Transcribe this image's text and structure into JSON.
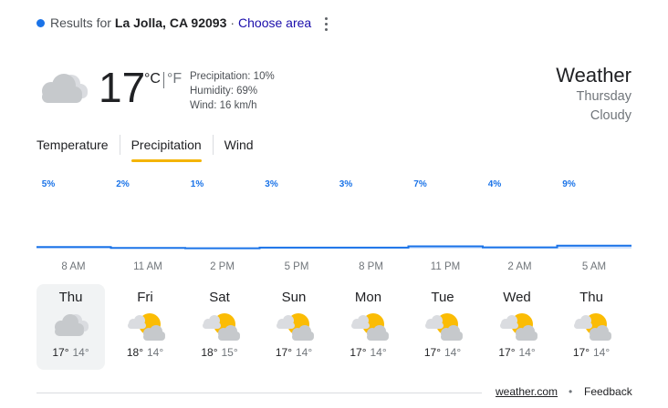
{
  "header": {
    "results_prefix": "Results for",
    "location": "La Jolla, CA 92093",
    "separator": "·",
    "choose_area": "Choose area"
  },
  "current": {
    "temperature": "17",
    "unit_c": "°C",
    "unit_f": "°F",
    "precipitation": "Precipitation: 10%",
    "humidity": "Humidity: 69%",
    "wind": "Wind: 16 km/h",
    "icon": "cloudy-icon"
  },
  "summary": {
    "title": "Weather",
    "day": "Thursday",
    "condition": "Cloudy"
  },
  "tabs": [
    {
      "label": "Temperature",
      "active": false
    },
    {
      "label": "Precipitation",
      "active": true
    },
    {
      "label": "Wind",
      "active": false
    }
  ],
  "chart_data": {
    "type": "area",
    "labels": [
      "5%",
      "2%",
      "1%",
      "3%",
      "3%",
      "7%",
      "4%",
      "9%"
    ],
    "values": [
      5,
      2,
      1,
      3,
      3,
      7,
      4,
      9
    ],
    "x": [
      "8 AM",
      "11 AM",
      "2 PM",
      "5 PM",
      "8 PM",
      "11 PM",
      "2 AM",
      "5 AM"
    ],
    "color": "#1a73e8",
    "ylim": [
      0,
      100
    ]
  },
  "days": [
    {
      "name": "Thu",
      "hi": "17°",
      "lo": "14°",
      "icon": "cloudy-icon",
      "selected": true
    },
    {
      "name": "Fri",
      "hi": "18°",
      "lo": "14°",
      "icon": "partly-cloudy-icon",
      "selected": false
    },
    {
      "name": "Sat",
      "hi": "18°",
      "lo": "15°",
      "icon": "partly-cloudy-icon",
      "selected": false
    },
    {
      "name": "Sun",
      "hi": "17°",
      "lo": "14°",
      "icon": "partly-cloudy-icon",
      "selected": false
    },
    {
      "name": "Mon",
      "hi": "17°",
      "lo": "14°",
      "icon": "partly-cloudy-icon",
      "selected": false
    },
    {
      "name": "Tue",
      "hi": "17°",
      "lo": "14°",
      "icon": "partly-cloudy-icon",
      "selected": false
    },
    {
      "name": "Wed",
      "hi": "17°",
      "lo": "14°",
      "icon": "partly-cloudy-icon",
      "selected": false
    },
    {
      "name": "Thu",
      "hi": "17°",
      "lo": "14°",
      "icon": "partly-cloudy-icon",
      "selected": false
    }
  ],
  "footer": {
    "source": "weather.com",
    "dot": "•",
    "feedback": "Feedback"
  },
  "colors": {
    "accent": "#1a73e8",
    "tab_underline": "#f4b400",
    "sun": "#fbbc04",
    "cloud": "#c6c9cc"
  }
}
